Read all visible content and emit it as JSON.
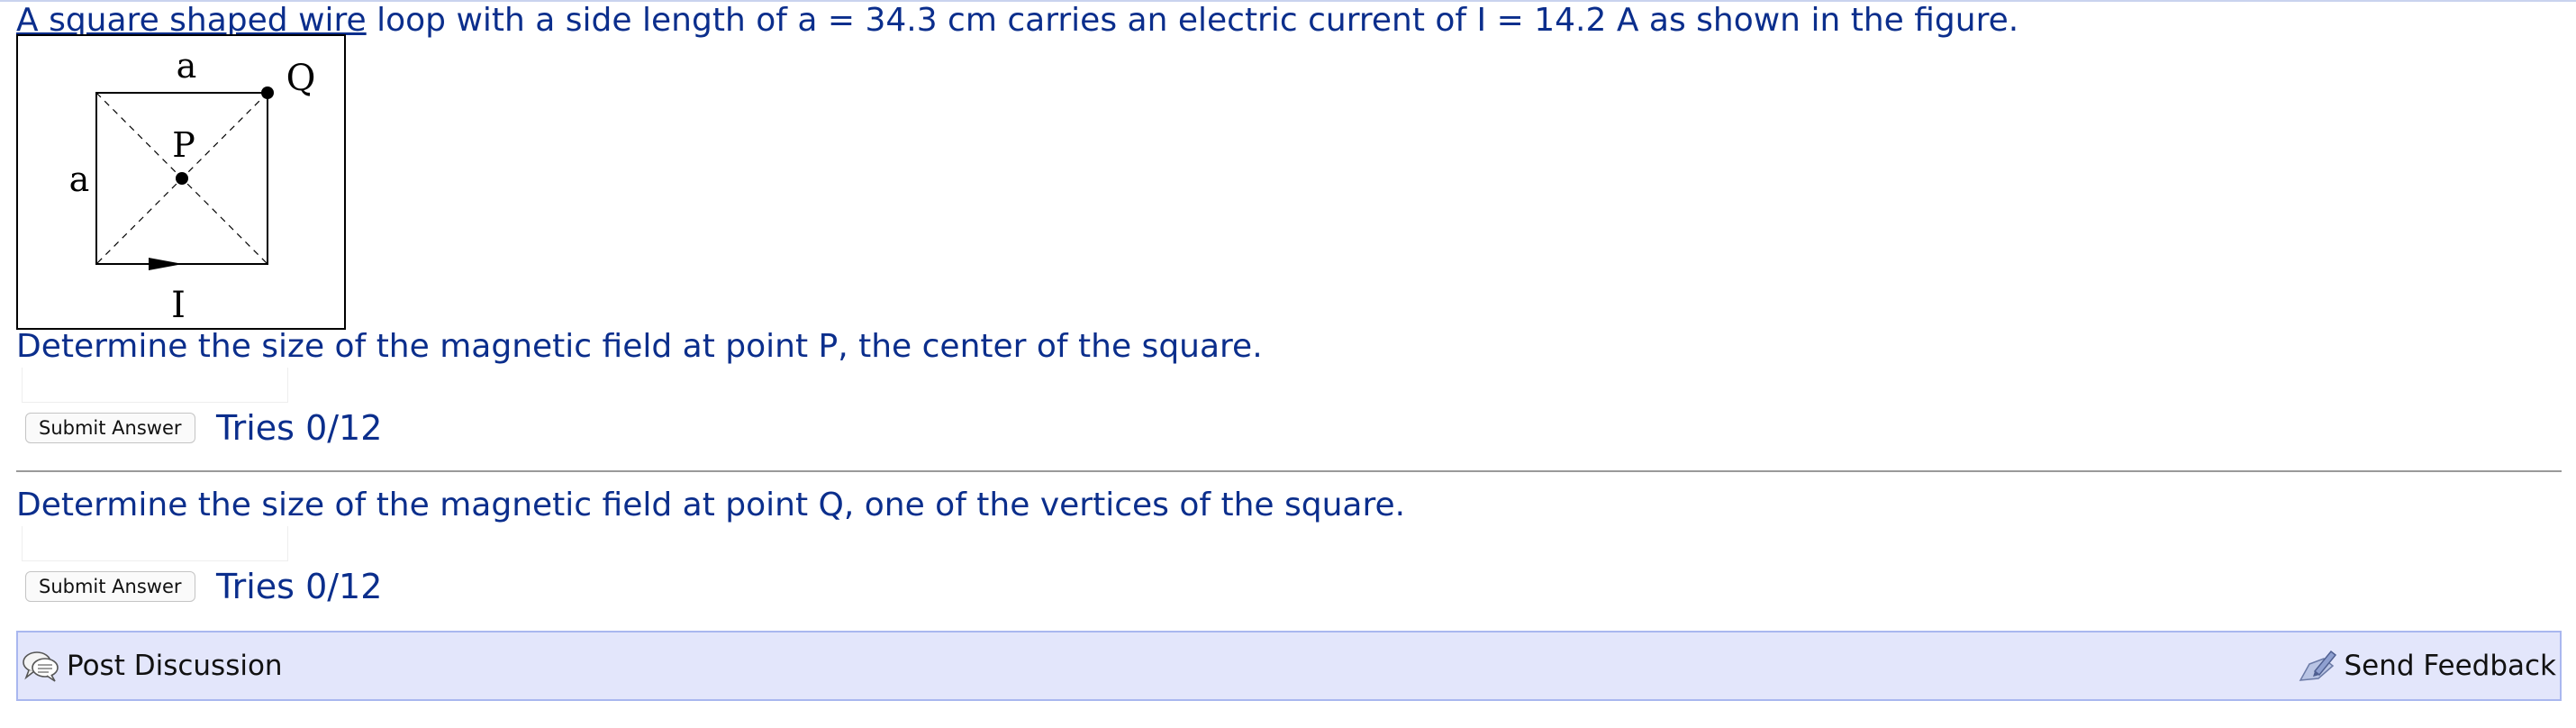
{
  "problem": {
    "text_underlined": "A square shaped wire",
    "text_rest": " loop with a side length of a = 34.3 cm carries an electric current of I = 14.2 A as shown in the figure."
  },
  "figure": {
    "label_top_side": "a",
    "label_left_side": "a",
    "label_center": "P",
    "label_corner": "Q",
    "label_current": "I"
  },
  "questions": [
    {
      "prompt": "Determine the size of the magnetic field at point P, the center of the square.",
      "answer_value": "",
      "submit_label": "Submit Answer",
      "tries": "Tries 0/12"
    },
    {
      "prompt": "Determine the size of the magnetic field at point Q, one of the vertices of the square.",
      "answer_value": "",
      "submit_label": "Submit Answer",
      "tries": "Tries 0/12"
    }
  ],
  "footer": {
    "post_discussion_label": "Post Discussion",
    "post_discussion_icon": "speech-bubbles-icon",
    "send_feedback_label": "Send Feedback",
    "send_feedback_icon": "feedback-pen-icon",
    "bar_color": "#e3e6fb",
    "border_color": "#a9b7ef"
  },
  "colors": {
    "text": "#0b2e8c",
    "divider": "#9a9a9a"
  }
}
